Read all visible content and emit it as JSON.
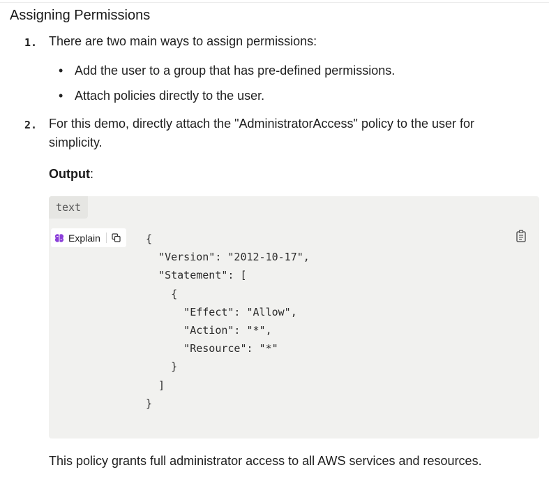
{
  "section_title": "Assigning Permissions",
  "steps": [
    {
      "number": "1.",
      "text": "There are two main ways to assign permissions:",
      "bullets": [
        "Add the user to a group that has pre-defined permissions.",
        "Attach policies directly to the user."
      ]
    },
    {
      "number": "2.",
      "text_line1": "For this demo, directly attach the \"AdministratorAccess\" policy to the user for",
      "text_line2": "simplicity."
    }
  ],
  "output": {
    "label": "Output",
    "colon": ":"
  },
  "code_block": {
    "language": "text",
    "explain_label": "Explain",
    "content": "{\n  \"Version\": \"2012-10-17\",\n  \"Statement\": [\n    {\n      \"Effect\": \"Allow\",\n      \"Action\": \"*\",\n      \"Resource\": \"*\"\n    }\n  ]\n}"
  },
  "footer_text": "This policy grants full administrator access to all AWS services and resources.",
  "icons": {
    "explain": "brain-icon",
    "copy": "copy-icon",
    "clipboard": "clipboard-icon"
  },
  "colors": {
    "code_background": "#f1f1ef",
    "language_tag_background": "#e6e6e3",
    "brain_icon": "#8b3fd9"
  }
}
